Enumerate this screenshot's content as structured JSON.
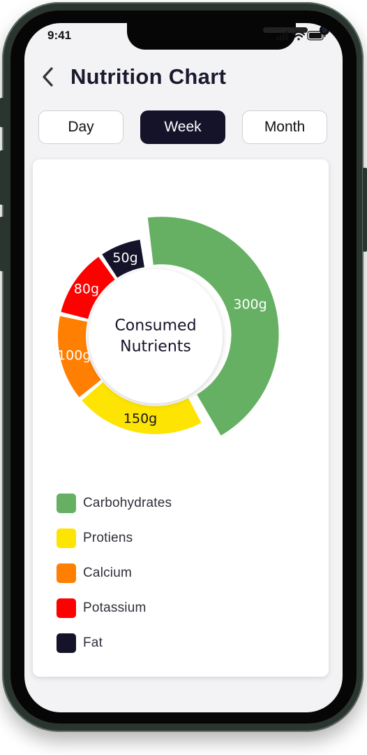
{
  "status_bar": {
    "time": "9:41"
  },
  "header": {
    "title": "Nutrition Chart"
  },
  "period_tabs": [
    {
      "label": "Day",
      "active": false
    },
    {
      "label": "Week",
      "active": true
    },
    {
      "label": "Month",
      "active": false
    }
  ],
  "chart_data": {
    "type": "pie",
    "center_label": [
      "Consumed",
      "Nutrients"
    ],
    "unit": "g",
    "series": [
      {
        "name": "Carbohydrates",
        "value": 300,
        "label": "300g",
        "color": "#66b063",
        "exploded": true
      },
      {
        "name": "Protiens",
        "value": 150,
        "label": "150g",
        "color": "#fde402"
      },
      {
        "name": "Calcium",
        "value": 100,
        "label": "100g",
        "color": "#fe7f01"
      },
      {
        "name": "Potassium",
        "value": 80,
        "label": "80g",
        "color": "#fd0000"
      },
      {
        "name": "Fat",
        "value": 50,
        "label": "50g",
        "color": "#14132a"
      }
    ]
  },
  "colors": {
    "background": "#f3f3f6",
    "active_tab": "#14132a",
    "title": "#1a1a2e"
  }
}
